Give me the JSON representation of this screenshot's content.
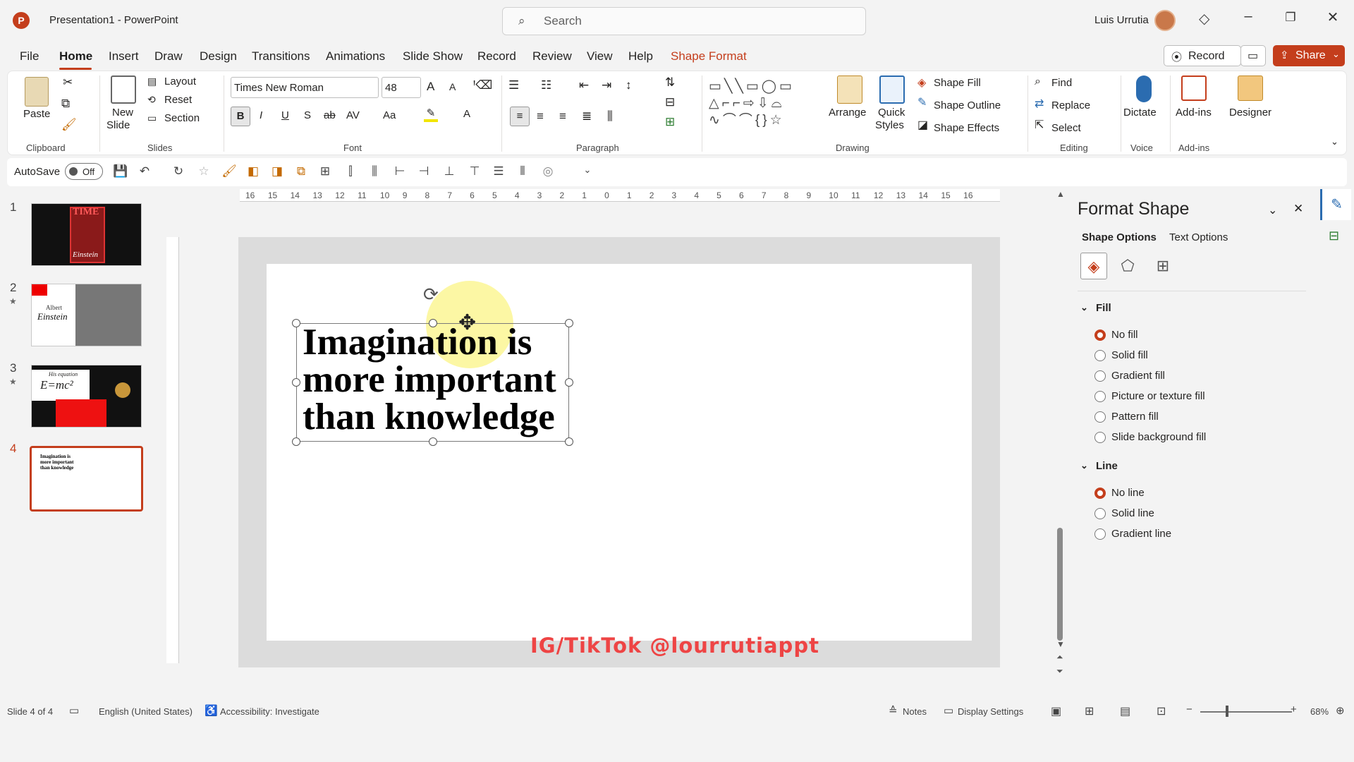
{
  "window": {
    "title": "Presentation1  -  PowerPoint",
    "search_placeholder": "Search",
    "user_name": "Luis Urrutia",
    "app_icon_letter": "P"
  },
  "menu": {
    "tabs": [
      "File",
      "Home",
      "Insert",
      "Draw",
      "Design",
      "Transitions",
      "Animations",
      "Slide Show",
      "Record",
      "Review",
      "View",
      "Help",
      "Shape Format"
    ],
    "active_tab": "Home",
    "record_label": "Record",
    "share_label": "Share"
  },
  "ribbon": {
    "clipboard": {
      "paste": "Paste",
      "group": "Clipboard"
    },
    "slides": {
      "new_slide_1": "New",
      "new_slide_2": "Slide",
      "layout": "Layout",
      "reset": "Reset",
      "section": "Section",
      "group": "Slides"
    },
    "font": {
      "name": "Times New Roman",
      "size": "48",
      "group": "Font",
      "b": "B",
      "i": "I",
      "u": "U",
      "s": "S",
      "abc": "ab",
      "av": "AV",
      "aa": "Aa",
      "a_grow": "A",
      "a_shrink": "A",
      "a_color": "A"
    },
    "paragraph": {
      "group": "Paragraph"
    },
    "drawing": {
      "arrange": "Arrange",
      "quick_styles_1": "Quick",
      "quick_styles_2": "Styles",
      "shape_fill": "Shape Fill",
      "shape_outline": "Shape Outline",
      "shape_effects": "Shape Effects",
      "group": "Drawing"
    },
    "editing": {
      "find": "Find",
      "replace": "Replace",
      "select": "Select",
      "group": "Editing"
    },
    "voice": {
      "dictate": "Dictate",
      "group": "Voice"
    },
    "addins": {
      "addins": "Add-ins",
      "group": "Add-ins"
    },
    "designer": {
      "label": "Designer"
    }
  },
  "qat": {
    "autosave": "AutoSave",
    "toggle": "Off"
  },
  "thumbnails": [
    {
      "num": "1",
      "star": "",
      "title": "TIME",
      "caption": "Einstein"
    },
    {
      "num": "2",
      "star": "★",
      "title": "Albert",
      "caption": "Einstein"
    },
    {
      "num": "3",
      "star": "★",
      "title": "His equation",
      "caption": "E=mc²"
    },
    {
      "num": "4",
      "star": "",
      "title": "",
      "caption": "Imagination is\nmore important\nthan knowledge"
    }
  ],
  "active_slide": "4",
  "ruler_labels": [
    "16",
    "15",
    "14",
    "13",
    "12",
    "11",
    "10",
    "9",
    "8",
    "7",
    "6",
    "5",
    "4",
    "3",
    "2",
    "1",
    "0",
    "1",
    "2",
    "3",
    "4",
    "5",
    "6",
    "7",
    "8",
    "9",
    "10",
    "11",
    "12",
    "13",
    "14",
    "15",
    "16"
  ],
  "slide": {
    "text": "Imagination is\nmore important\nthan knowledge",
    "watermark": "IG/TikTok @lourrutiappt"
  },
  "format_pane": {
    "title": "Format Shape",
    "subtabs": [
      "Shape Options",
      "Text Options"
    ],
    "fill_section": "Fill",
    "fill_options": [
      "No fill",
      "Solid fill",
      "Gradient fill",
      "Picture or texture fill",
      "Pattern fill",
      "Slide background fill"
    ],
    "fill_selected": "No fill",
    "line_section": "Line",
    "line_options": [
      "No line",
      "Solid line",
      "Gradient line"
    ],
    "line_selected": "No line"
  },
  "status": {
    "slide_info": "Slide 4 of 4",
    "language": "English (United States)",
    "accessibility": "Accessibility: Investigate",
    "notes": "Notes",
    "display_settings": "Display Settings",
    "zoom": "68%"
  },
  "colors": {
    "accent": "#c43e1c",
    "watermark": "#ee4444",
    "highlight": "#faf05a"
  }
}
